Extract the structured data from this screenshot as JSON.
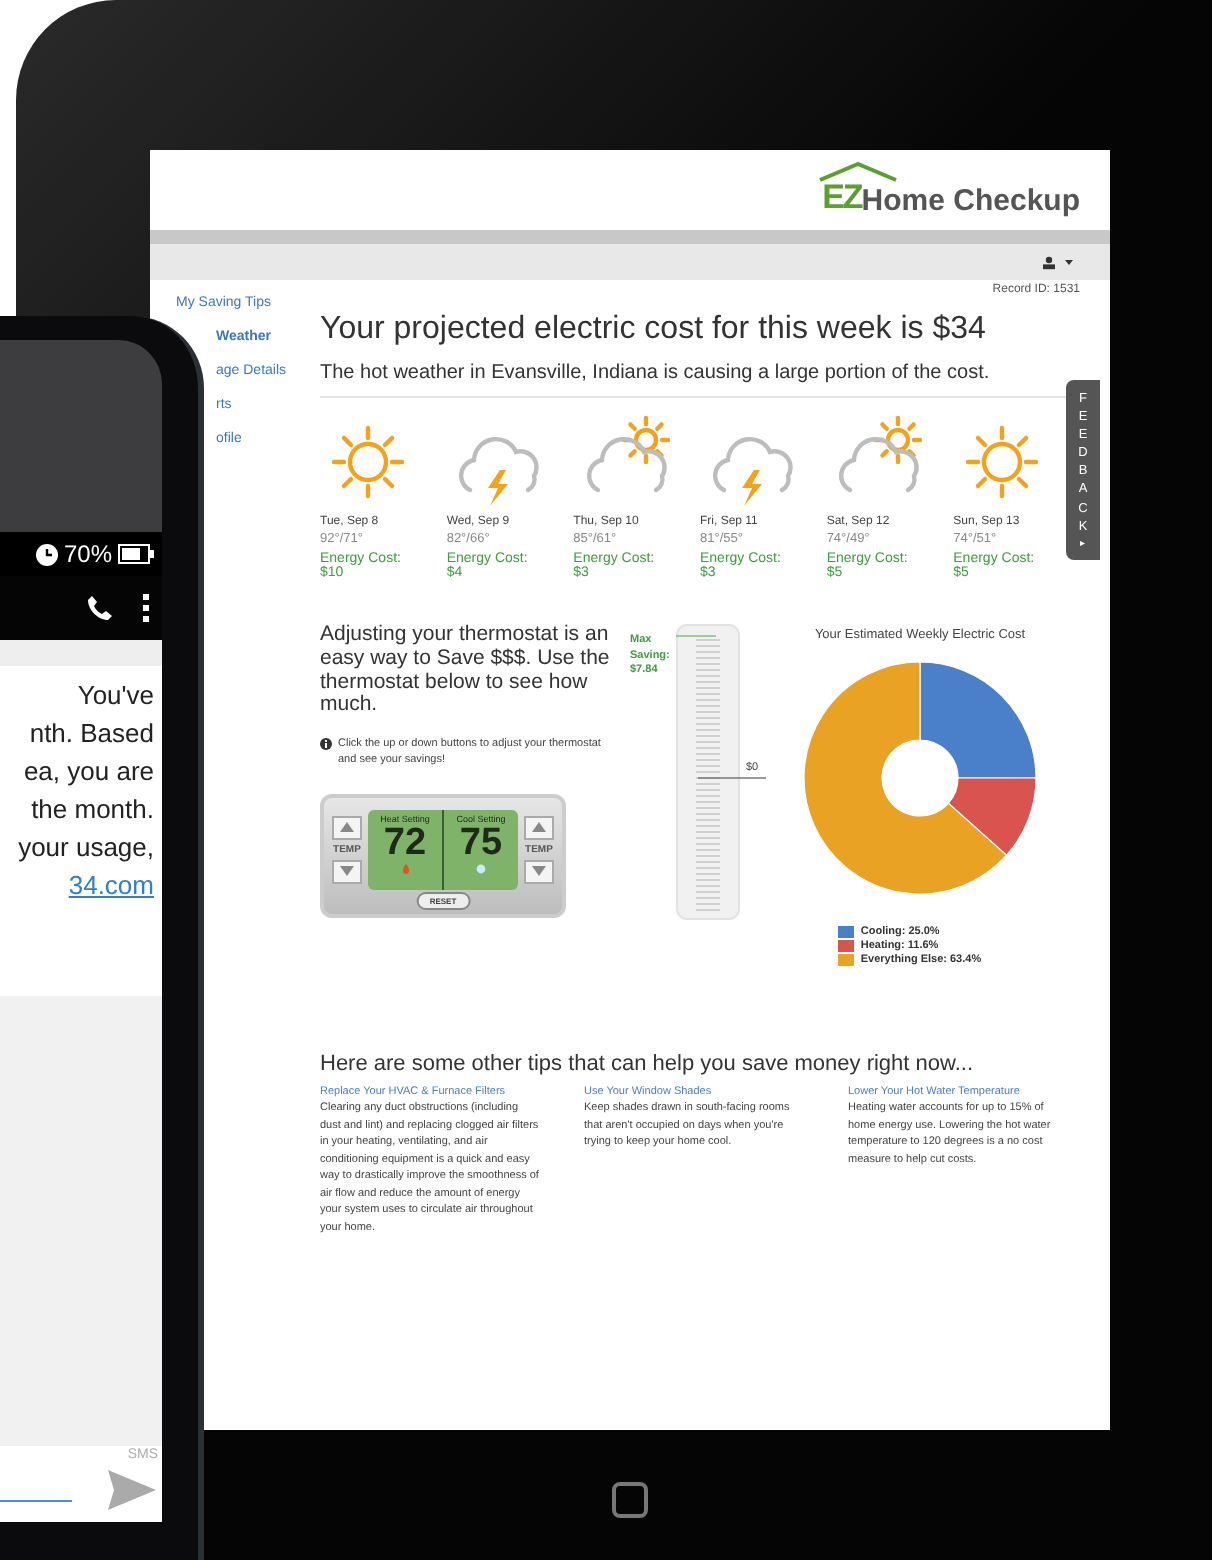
{
  "phone": {
    "status": {
      "battery": "70%"
    },
    "message_lines": [
      "You've",
      "nth. Based",
      "ea, you are",
      "the month.",
      "your usage,"
    ],
    "message_link": "34.com",
    "send_label": "SMS"
  },
  "site": {
    "logo": {
      "mark": "EZ",
      "name": "Home Checkup"
    },
    "record_id": "Record ID: 1531",
    "sidebar": [
      {
        "label": "My Saving Tips",
        "selected": false
      },
      {
        "label": "Weather",
        "selected": true
      },
      {
        "label": "age Details",
        "selected": false
      },
      {
        "label": "rts",
        "selected": false
      },
      {
        "label": "ofile",
        "selected": false
      }
    ],
    "title": "Your projected electric cost for this week is $34",
    "subtitle": "The hot weather in Evansville, Indiana is causing a large portion of the cost.",
    "forecast": [
      {
        "kind": "sunny",
        "date": "Tue, Sep 8",
        "temps": "92°/71°",
        "cost": "Energy Cost: $10"
      },
      {
        "kind": "storm",
        "date": "Wed, Sep 9",
        "temps": "82°/66°",
        "cost": "Energy Cost: $4"
      },
      {
        "kind": "partly",
        "date": "Thu, Sep 10",
        "temps": "85°/61°",
        "cost": "Energy Cost: $3"
      },
      {
        "kind": "storm",
        "date": "Fri, Sep 11",
        "temps": "81°/55°",
        "cost": "Energy Cost: $3"
      },
      {
        "kind": "partly",
        "date": "Sat, Sep 12",
        "temps": "74°/49°",
        "cost": "Energy Cost: $5"
      },
      {
        "kind": "sunny",
        "date": "Sun, Sep 13",
        "temps": "74°/51°",
        "cost": "Energy Cost: $5"
      }
    ],
    "feedback": {
      "label": "FEEDBACK",
      "arrow": "▸"
    },
    "thermostat_intro": "Adjusting your thermostat is an easy way to Save $$$. Use the thermostat below to see how much.",
    "thermostat_hint": "Click the up or down buttons to adjust your thermostat and see your savings!",
    "thermostat": {
      "temp_labels": [
        "TEMP",
        "TEMP"
      ],
      "heat_label": "Heat Setting",
      "heat_value": "72",
      "cool_label": "Cool Setting",
      "cool_value": "75",
      "reset": "RESET"
    },
    "savings_gauge": {
      "max_label": "Max Saving: $7.84",
      "zero_label": "$0"
    },
    "cost_chart": {
      "chart_data": {
        "type": "donut",
        "title": "Your Estimated Weekly Electric Cost",
        "categories": [
          "Cooling: 25.0%",
          "Heating: 11.6%",
          "Everything Else: 63.4%"
        ],
        "values": [
          25.0,
          11.6,
          63.4
        ]
      },
      "slices": [
        {
          "color": "#4a7fc9"
        },
        {
          "color": "#d9534f"
        },
        {
          "color": "#e9a224"
        }
      ]
    },
    "tips_heading": "Here are some other tips that can help you save money right now...",
    "tips": [
      {
        "title": "Replace Your HVAC & Furnace Filters",
        "body": "Clearing any duct obstructions (including dust and lint) and replacing clogged air filters in your heating, ventilating, and air conditioning equipment is a quick and easy way to drastically improve the smoothness of air flow and reduce the amount of energy your system uses to circulate air throughout your home."
      },
      {
        "title": "Use Your Window Shades",
        "body": "Keep shades drawn in south-facing rooms that aren't occupied on days when you're trying to keep your home cool."
      },
      {
        "title": "Lower Your Hot Water Temperature",
        "body": "Heating water accounts for up to 15% of home energy use. Lowering the hot water temperature to 120 degrees is a no cost measure to help cut costs."
      }
    ]
  }
}
